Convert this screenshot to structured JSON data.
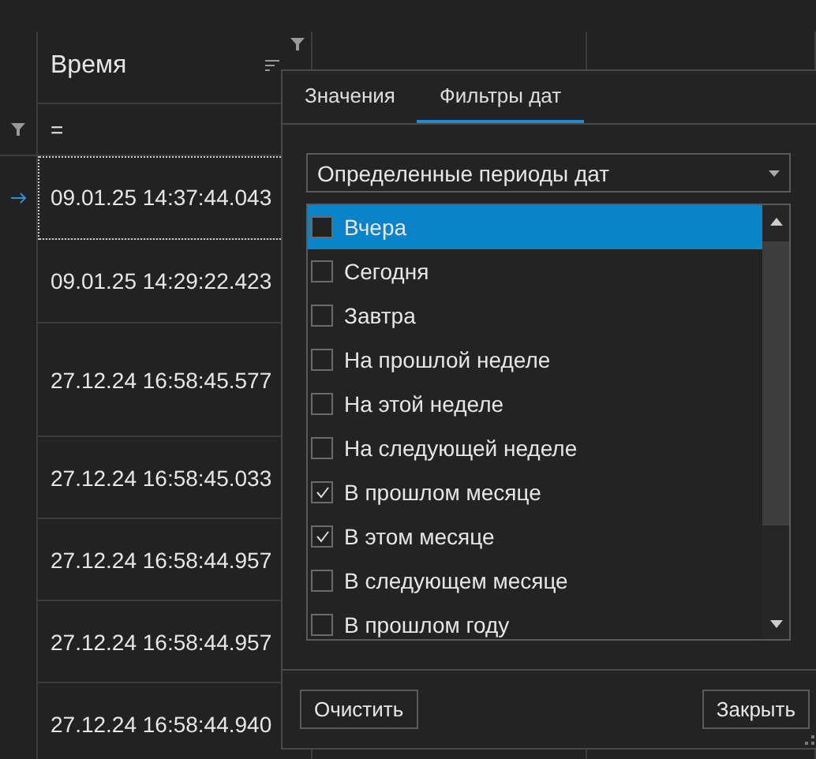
{
  "grid": {
    "columns": [
      "Время"
    ],
    "filter_row": {
      "operator": "="
    },
    "rows": [
      {
        "time": "09.01.25 14:37:44.043",
        "current": true
      },
      {
        "time": "09.01.25 14:29:22.423",
        "current": false
      },
      {
        "time": "27.12.24 16:58:45.577",
        "current": false
      },
      {
        "time": "27.12.24 16:58:45.033",
        "current": false
      },
      {
        "time": "27.12.24 16:58:44.957",
        "current": false
      },
      {
        "time": "27.12.24 16:58:44.957",
        "current": false
      },
      {
        "time": "27.12.24 16:58:44.940",
        "current": false
      }
    ]
  },
  "popup": {
    "tabs": [
      {
        "label": "Значения",
        "selected": false
      },
      {
        "label": "Фильтры дат",
        "selected": true
      }
    ],
    "period_select": {
      "value": "Определенные периоды дат"
    },
    "periods": [
      {
        "label": "Вчера",
        "checked": false,
        "selected": true
      },
      {
        "label": "Сегодня",
        "checked": false,
        "selected": false
      },
      {
        "label": "Завтра",
        "checked": false,
        "selected": false
      },
      {
        "label": "На прошлой неделе",
        "checked": false,
        "selected": false
      },
      {
        "label": "На этой неделе",
        "checked": false,
        "selected": false
      },
      {
        "label": "На следующей неделе",
        "checked": false,
        "selected": false
      },
      {
        "label": "В прошлом месяце",
        "checked": true,
        "selected": false
      },
      {
        "label": "В этом месяце",
        "checked": true,
        "selected": false
      },
      {
        "label": "В следующем месяце",
        "checked": false,
        "selected": false
      },
      {
        "label": "В прошлом году",
        "checked": false,
        "selected": false
      }
    ],
    "buttons": [
      "Очистить",
      "Закрыть"
    ]
  }
}
